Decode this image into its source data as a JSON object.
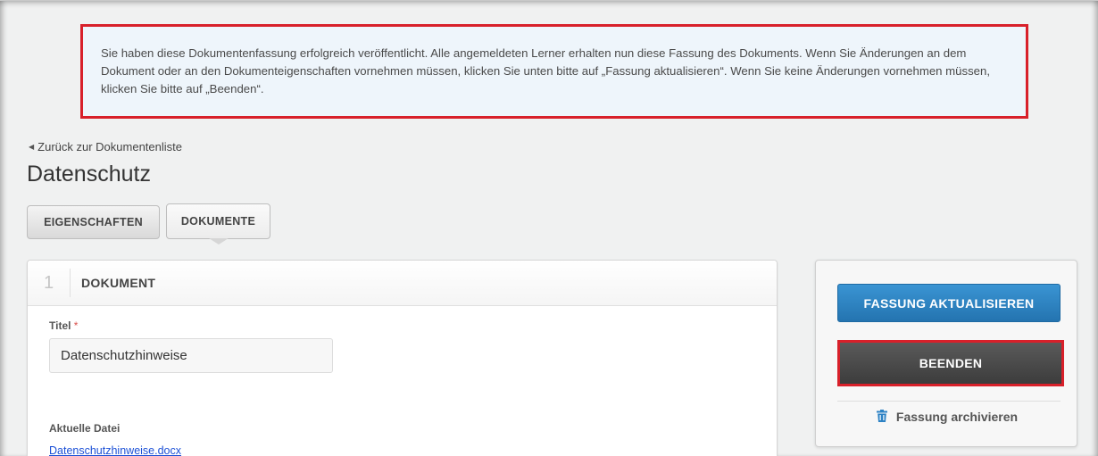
{
  "notice": {
    "text": "Sie haben diese Dokumentenfassung erfolgreich veröffentlicht. Alle angemeldeten Lerner erhalten nun diese Fassung des Dokuments. Wenn Sie Änderungen an dem Dokument oder an den Dokumenteigenschaften vornehmen müssen, klicken Sie unten bitte auf „Fassung aktualisieren“. Wenn Sie keine Änderungen vornehmen müssen, klicken Sie bitte auf „Beenden“."
  },
  "nav": {
    "back_label": "Zurück zur Dokumentenliste"
  },
  "page": {
    "title": "Datenschutz"
  },
  "tabs": [
    {
      "label": "EIGENSCHAFTEN"
    },
    {
      "label": "DOKUMENTE"
    }
  ],
  "document_card": {
    "number": "1",
    "title": "DOKUMENT",
    "title_field_label": "Titel",
    "required_marker": "*",
    "title_value": "Datenschutzhinweise",
    "current_file_label": "Aktuelle Datei",
    "current_file_name": "Datenschutzhinweise.docx"
  },
  "actions": {
    "update_label": "FASSUNG AKTUALISIEREN",
    "finish_label": "BEENDEN",
    "archive_label": "Fassung archivieren"
  },
  "colors": {
    "highlight": "#d8202a",
    "primary": "#2c82c4",
    "dark_button": "#4a4a4a",
    "link": "#1a4fd6"
  },
  "icons": {
    "back": "triangle-left-icon",
    "archive": "trash-icon"
  }
}
